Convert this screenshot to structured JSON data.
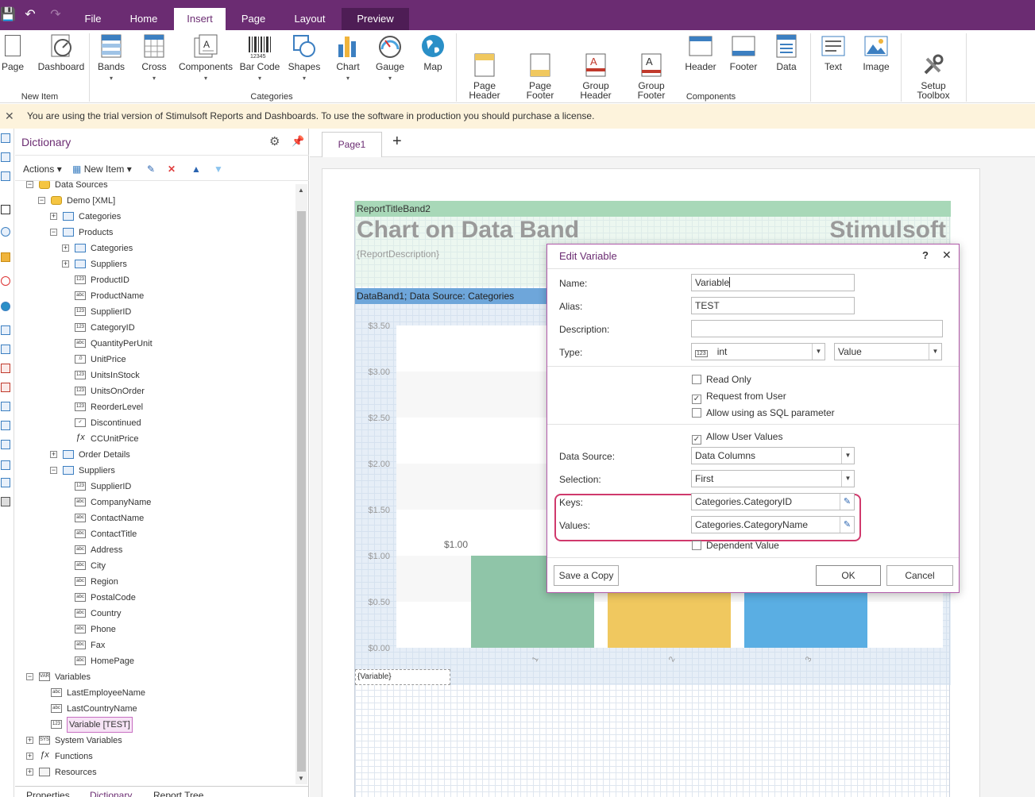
{
  "quick_access": {
    "save": "💾",
    "undo": "↶",
    "redo": "↷"
  },
  "tabs": [
    "File",
    "Home",
    "Insert",
    "Page",
    "Layout",
    "Preview"
  ],
  "ribbon": {
    "buttons": [
      {
        "label": "Page",
        "sub": ""
      },
      {
        "label": "Dashboard",
        "sub": ""
      },
      {
        "label": "Bands",
        "sub": "▾"
      },
      {
        "label": "Cross",
        "sub": "▾"
      },
      {
        "label": "Components",
        "sub": "▾"
      },
      {
        "label": "Bar Code",
        "sub": "▾"
      },
      {
        "label": "Shapes",
        "sub": "▾"
      },
      {
        "label": "Chart",
        "sub": "▾"
      },
      {
        "label": "Gauge",
        "sub": "▾"
      },
      {
        "label": "Map",
        "sub": ""
      },
      {
        "label": "Page\nHeader",
        "sub": ""
      },
      {
        "label": "Page\nFooter",
        "sub": ""
      },
      {
        "label": "Group\nHeader",
        "sub": ""
      },
      {
        "label": "Group\nFooter",
        "sub": ""
      },
      {
        "label": "Header",
        "sub": ""
      },
      {
        "label": "Footer",
        "sub": ""
      },
      {
        "label": "Data",
        "sub": ""
      },
      {
        "label": "Text",
        "sub": ""
      },
      {
        "label": "Image",
        "sub": ""
      },
      {
        "label": "Setup\nToolbox",
        "sub": ""
      }
    ],
    "groups": [
      "New Item",
      "Categories",
      "Components"
    ]
  },
  "trial_message": "You are using the trial version of Stimulsoft Reports and Dashboards. To use the software in production you should purchase a license.",
  "dictionary": {
    "title": "Dictionary",
    "actions_label": "Actions",
    "new_item_label": "New Item",
    "tree": [
      {
        "label": "Data Sources",
        "level": 0,
        "exp": "-",
        "icon": "db"
      },
      {
        "label": "Demo [XML]",
        "level": 1,
        "exp": "-",
        "icon": "db"
      },
      {
        "label": "Categories",
        "level": 2,
        "exp": "+",
        "icon": "table"
      },
      {
        "label": "Products",
        "level": 2,
        "exp": "-",
        "icon": "table"
      },
      {
        "label": "Categories",
        "level": 3,
        "exp": "+",
        "icon": "rel"
      },
      {
        "label": "Suppliers",
        "level": 3,
        "exp": "+",
        "icon": "rel"
      },
      {
        "label": "ProductID",
        "level": 3,
        "exp": "",
        "icon": "123"
      },
      {
        "label": "ProductName",
        "level": 3,
        "exp": "",
        "icon": "abc"
      },
      {
        "label": "SupplierID",
        "level": 3,
        "exp": "",
        "icon": "123"
      },
      {
        "label": "CategoryID",
        "level": 3,
        "exp": "",
        "icon": "123"
      },
      {
        "label": "QuantityPerUnit",
        "level": 3,
        "exp": "",
        "icon": "abc"
      },
      {
        "label": "UnitPrice",
        "level": 3,
        "exp": "",
        "icon": ".0"
      },
      {
        "label": "UnitsInStock",
        "level": 3,
        "exp": "",
        "icon": "123"
      },
      {
        "label": "UnitsOnOrder",
        "level": 3,
        "exp": "",
        "icon": "123"
      },
      {
        "label": "ReorderLevel",
        "level": 3,
        "exp": "",
        "icon": "123"
      },
      {
        "label": "Discontinued",
        "level": 3,
        "exp": "",
        "icon": "chk"
      },
      {
        "label": "CCUnitPrice",
        "level": 3,
        "exp": "",
        "icon": "fx"
      },
      {
        "label": "Order Details",
        "level": 2,
        "exp": "+",
        "icon": "table"
      },
      {
        "label": "Suppliers",
        "level": 2,
        "exp": "-",
        "icon": "table"
      },
      {
        "label": "SupplierID",
        "level": 3,
        "exp": "",
        "icon": "123"
      },
      {
        "label": "CompanyName",
        "level": 3,
        "exp": "",
        "icon": "abc"
      },
      {
        "label": "ContactName",
        "level": 3,
        "exp": "",
        "icon": "abc"
      },
      {
        "label": "ContactTitle",
        "level": 3,
        "exp": "",
        "icon": "abc"
      },
      {
        "label": "Address",
        "level": 3,
        "exp": "",
        "icon": "abc"
      },
      {
        "label": "City",
        "level": 3,
        "exp": "",
        "icon": "abc"
      },
      {
        "label": "Region",
        "level": 3,
        "exp": "",
        "icon": "abc"
      },
      {
        "label": "PostalCode",
        "level": 3,
        "exp": "",
        "icon": "abc"
      },
      {
        "label": "Country",
        "level": 3,
        "exp": "",
        "icon": "abc"
      },
      {
        "label": "Phone",
        "level": 3,
        "exp": "",
        "icon": "abc"
      },
      {
        "label": "Fax",
        "level": 3,
        "exp": "",
        "icon": "abc"
      },
      {
        "label": "HomePage",
        "level": 3,
        "exp": "",
        "icon": "abc"
      },
      {
        "label": "Variables",
        "level": 0,
        "exp": "-",
        "icon": "var"
      },
      {
        "label": "LastEmployeeName",
        "level": 1,
        "exp": "",
        "icon": "abc"
      },
      {
        "label": "LastCountryName",
        "level": 1,
        "exp": "",
        "icon": "abc"
      },
      {
        "label": "Variable [TEST]",
        "level": 1,
        "exp": "",
        "icon": "123",
        "selected": true
      },
      {
        "label": "System Variables",
        "level": 0,
        "exp": "+",
        "icon": "sys"
      },
      {
        "label": "Functions",
        "level": 0,
        "exp": "+",
        "icon": "fx"
      },
      {
        "label": "Resources",
        "level": 0,
        "exp": "+",
        "icon": "res"
      }
    ],
    "bottom_tabs": [
      "Properties",
      "Dictionary",
      "Report Tree"
    ]
  },
  "designer": {
    "page_tab": "Page1",
    "add_tab": "+",
    "report_title_band": "ReportTitleBand2",
    "title_text": "Chart on Data Band",
    "brand_text": "Stimulsoft",
    "description": "{ReportDescription}",
    "data_band": "DataBand1; Data Source: Categories",
    "variable_field": "{Variable}"
  },
  "chart_data": {
    "type": "bar",
    "categories": [
      "1",
      "2",
      "3"
    ],
    "values": [
      1.0,
      1.0,
      1.0
    ],
    "ylim": [
      0,
      3.5
    ],
    "yticks": [
      "$0.00",
      "$0.50",
      "$1.00",
      "$1.50",
      "$2.00",
      "$2.50",
      "$3.00",
      "$3.50"
    ],
    "data_labels": [
      "$1.00",
      "",
      ""
    ],
    "colors": [
      "#8fc5a8",
      "#f0c85f",
      "#5aaee3"
    ]
  },
  "dialog": {
    "title": "Edit Variable",
    "help": "?",
    "close": "✕",
    "name_label": "Name:",
    "name_value": "Variable",
    "alias_label": "Alias:",
    "alias_value": "TEST",
    "description_label": "Description:",
    "description_value": "",
    "type_label": "Type:",
    "type_value": "int",
    "type_kind": "Value",
    "read_only": "Read Only",
    "request_from_user": "Request from User",
    "allow_sql": "Allow using as SQL parameter",
    "allow_user_values": "Allow User Values",
    "data_source_label": "Data Source:",
    "data_source_value": "Data Columns",
    "selection_label": "Selection:",
    "selection_value": "First",
    "keys_label": "Keys:",
    "keys_value": "Categories.CategoryID",
    "values_label": "Values:",
    "values_value": "Categories.CategoryName",
    "dependent_value": "Dependent Value",
    "save_copy": "Save a Copy",
    "ok": "OK",
    "cancel": "Cancel",
    "accent_color": "#6b2c72",
    "highlight_color": "#d0396c"
  }
}
